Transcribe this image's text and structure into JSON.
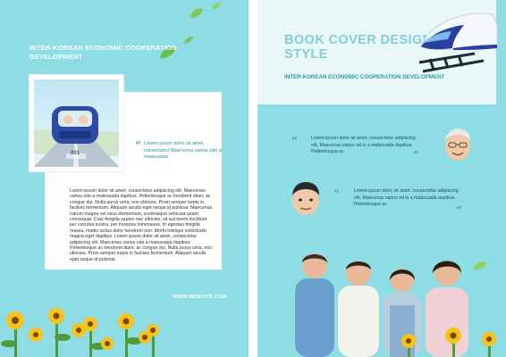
{
  "left_page": {
    "title": "INTER-KOREAN ECONOMIC COOPERATION DEVELOPMENT",
    "photo_plate": "001",
    "quote_open": "“",
    "quote_text": "Lorem ipsum dolor sit amet, consectetur Maecenas varius odo a malesuada",
    "body": "Lorem ipsum dolor sit amet, consectetur adipiscing elit. Maecenas varius odo a malesuada dapibus. Pellentesque ac hendrerit diam, ac congue dui. Nulla purus urna, non ultricies. Proin semper turpis in facilisis fermentum. Aliquam iaculis eget neque id pulvinar. Maecenas rutrum magna vel risus elementum, scelerisque vehicula quam consequat. Cras fringilla sapien nec ultricies, sit aut lorem tincidunt per conubia nostra, per inceptos himenaeos. In egestas fringilla massa, mattis iuctus dolor hendrerit non. Morbi tristique sollicitudin magna eget dapibus. Lorem ipsum dolor sit amet, consectetur adipiscing elit. Maecenas varius odo a malesuada dapibus. Pellentesque ac hendrerit diam, ac congue dui. Nulla purus urna, non ultricies. Proin semper turpis in facilisis fermentum. Aliquam iaculis eget neque id pulvinar.",
    "website": "WWW.WEBSITE.COM"
  },
  "right_page": {
    "title": "BOOK COVER DESIGN STYLE",
    "subtitle": "INTER-KOREAN ECONOMIC COOPERATION DEVELOPMENT",
    "quote1_open": "“",
    "quote1_text": "Lorem ipsum dolor sit amet, consectetur adipiscing elit, Maecenas varius od io a malesuada dapibus. Pellentesque ac",
    "quote1_close": "”",
    "quote2_open": "“",
    "quote2_text": "Lorem ipsum dolor sit amet, consectetur adipiscing elit, Maecenas varius od io a malesuada dapibus. Pellentesque ac",
    "quote2_close": "”"
  },
  "colors": {
    "background": "#8fdde4",
    "accent": "#35a9b4",
    "header_panel": "#e9f7f7",
    "title_color": "#7fcfd8"
  },
  "icons": [
    "leaf-icon",
    "train-icon",
    "car-icon",
    "sunflower-icon",
    "quote-icon"
  ]
}
